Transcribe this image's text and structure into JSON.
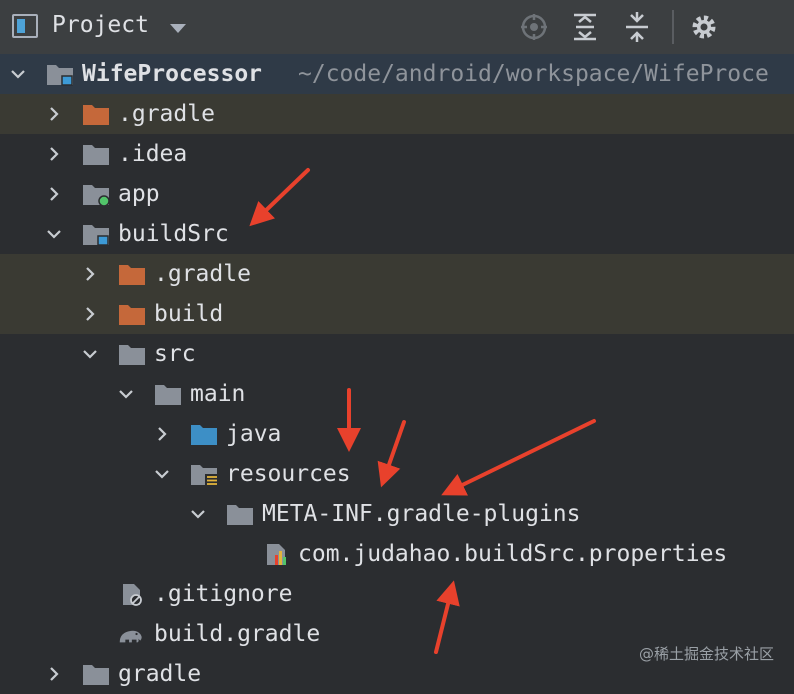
{
  "toolbar": {
    "title": "Project",
    "icons": [
      "project-icon",
      "dropdown-icon",
      "locate-icon",
      "expand-all-icon",
      "collapse-all-icon",
      "gear-icon"
    ]
  },
  "tree": {
    "root": {
      "name": "WifeProcessor",
      "path": "~/code/android/workspace/WifeProce"
    },
    "gradle_dir": ".gradle",
    "idea_dir": ".idea",
    "app_dir": "app",
    "buildsrc_dir": "buildSrc",
    "buildsrc_gradle": ".gradle",
    "buildsrc_build": "build",
    "src_dir": "src",
    "main_dir": "main",
    "java_dir": "java",
    "resources_dir": "resources",
    "meta_dir": "META-INF.gradle-plugins",
    "properties_file": "com.judahao.buildSrc.properties",
    "gitignore_file": ".gitignore",
    "build_gradle_file": "build.gradle",
    "gradle_root_dir": "gradle"
  },
  "colors": {
    "bg": "#2b2d30",
    "toolbar": "#3c3f41",
    "folder_gray": "#8a9099",
    "folder_orange": "#c5683a",
    "folder_blue": "#3d8fc6",
    "annotation_red": "#e8412c"
  },
  "watermark": "@稀土掘金技术社区"
}
